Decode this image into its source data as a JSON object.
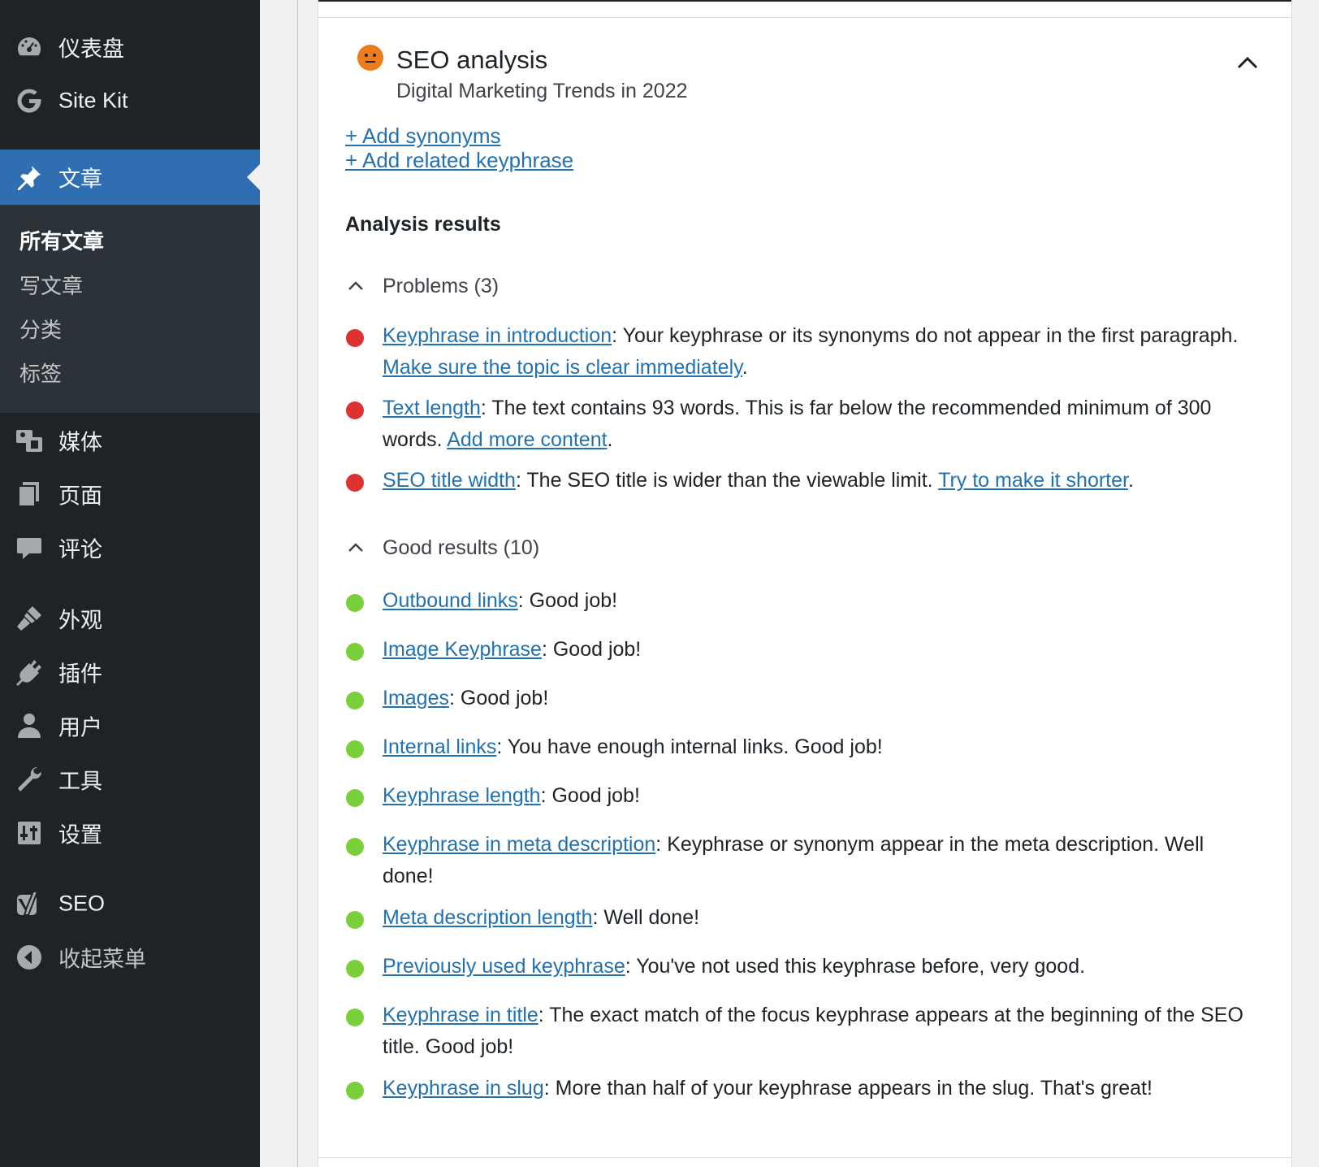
{
  "sidebar": {
    "items": [
      {
        "key": "dashboard",
        "label": "仪表盘",
        "icon": "dashboard-icon"
      },
      {
        "key": "sitekit",
        "label": "Site Kit",
        "icon": "google-g-icon"
      },
      {
        "key": "posts",
        "label": "文章",
        "icon": "pin-icon"
      },
      {
        "key": "media",
        "label": "媒体",
        "icon": "media-icon"
      },
      {
        "key": "pages",
        "label": "页面",
        "icon": "pages-icon"
      },
      {
        "key": "comments",
        "label": "评论",
        "icon": "comment-icon"
      },
      {
        "key": "appearance",
        "label": "外观",
        "icon": "brush-icon"
      },
      {
        "key": "plugins",
        "label": "插件",
        "icon": "plugin-icon"
      },
      {
        "key": "users",
        "label": "用户",
        "icon": "user-icon"
      },
      {
        "key": "tools",
        "label": "工具",
        "icon": "wrench-icon"
      },
      {
        "key": "settings",
        "label": "设置",
        "icon": "settings-icon"
      },
      {
        "key": "seo",
        "label": "SEO",
        "icon": "yoast-icon"
      },
      {
        "key": "collapse",
        "label": "收起菜单",
        "icon": "collapse-arrow-icon"
      }
    ],
    "submenu": [
      "所有文章",
      "写文章",
      "分类",
      "标签"
    ]
  },
  "seo": {
    "title": "SEO analysis",
    "keyphrase": "Digital Marketing Trends in 2022",
    "status_color": "#ee7c1b",
    "add_synonyms": "+ Add synonyms",
    "add_related": "+ Add related keyphrase",
    "results_heading": "Analysis results",
    "problems_label": "Problems (3)",
    "good_label": "Good results (10)",
    "problems": [
      {
        "link": "Keyphrase in introduction",
        "text": ": Your keyphrase or its synonyms do not appear in the first paragraph. ",
        "fix": "Make sure the topic is clear immediately",
        "end": "."
      },
      {
        "link": "Text length",
        "text": ": The text contains 93 words. This is far below the recommended minimum of 300 words. ",
        "fix": "Add more content",
        "end": "."
      },
      {
        "link": "SEO title width",
        "text": ": The SEO title is wider than the viewable limit. ",
        "fix": "Try to make it shorter",
        "end": "."
      }
    ],
    "good": [
      {
        "link": "Outbound links",
        "text": ": Good job!"
      },
      {
        "link": "Image Keyphrase",
        "text": ": Good job!"
      },
      {
        "link": "Images",
        "text": ": Good job!"
      },
      {
        "link": "Internal links",
        "text": ": You have enough internal links. Good job!"
      },
      {
        "link": "Keyphrase length",
        "text": ": Good job!"
      },
      {
        "link": "Keyphrase in meta description",
        "text": ": Keyphrase or synonym appear in the meta description. Well done!"
      },
      {
        "link": "Meta description length",
        "text": ": Well done!"
      },
      {
        "link": "Previously used keyphrase",
        "text": ": You've not used this keyphrase before, very good."
      },
      {
        "link": "Keyphrase in title",
        "text": ": The exact match of the focus keyphrase appears at the beginning of the SEO title. Good job!"
      },
      {
        "link": "Keyphrase in slug",
        "text": ": More than half of your keyphrase appears in the slug. That's great!"
      }
    ],
    "colors": {
      "problem": "#dc3232",
      "good": "#7ad03a",
      "link": "#2271b1"
    }
  }
}
